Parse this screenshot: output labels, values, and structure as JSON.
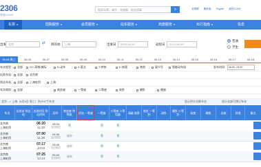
{
  "brand": {
    "logo": "2306",
    "subtitle": "铁路12306"
  },
  "search": {
    "placeholder": "搜索车票、餐饮、常旅客、相关规章"
  },
  "toplinks": [
    "无障碍",
    "敬老版",
    "English",
    "我的12306"
  ],
  "nav": [
    "车票",
    "团购服务",
    "会员服务",
    "站车服务",
    "商旅服务",
    "出行指南",
    "信息"
  ],
  "query": {
    "from_label": "出发地",
    "from_value": "北京",
    "to_label": "目的地",
    "to_value": "上海",
    "date_label": "出发日",
    "date_value": "2024-06-05",
    "return_label": "返程日",
    "return_value": "2024-06-05",
    "options": [
      "普通",
      "学生"
    ]
  },
  "dates": [
    "06-05 周三",
    "06-06",
    "06-07",
    "06-08",
    "06-09",
    "06-10",
    "06-11",
    "06-12",
    "06-13",
    "06-14",
    "06-15",
    "06-16",
    "06-17",
    "06-18"
  ],
  "filters": {
    "types_label": "车次类型：",
    "types": [
      "全部",
      "GC-高铁/城际",
      "D-动车",
      "Z-直达",
      "T-特快",
      "K-快速",
      "其他",
      "复兴号",
      "智能动车组"
    ],
    "depart_time_label": "发车时间：",
    "depart_time_value": "00:00--24:00",
    "from_label": "出发车站：",
    "from_stations": [
      "全部",
      "北京南"
    ],
    "to_label": "到达车站：",
    "to_stations": [
      "全部",
      "上海虹桥",
      "上海"
    ],
    "seat_label": "车次席别：",
    "seats": [
      "全部",
      "商务座",
      "一等座",
      "二等座",
      "软卧",
      "硬卧",
      "硬座"
    ]
  },
  "notice": "北京 --> 上海（6月5日 周三）共计47个车次",
  "notice_right": [
    "显示积分兑换车次",
    "显示全部可预订车次"
  ],
  "table": {
    "headers": [
      "车次",
      "出发站 到达站",
      "出发时间 到达时间",
      "历时",
      "商务座 特等座",
      "优选 一等座",
      "一等座",
      "二等座 二等包座",
      "高级 软卧",
      "软卧 一等卧",
      "动卧",
      "硬卧 二等卧",
      "软座",
      "硬座",
      "无座",
      "其他",
      "备注"
    ],
    "rows": [
      {
        "from": "北京南",
        "to": "上海虹桥",
        "dep": "06:20",
        "arr": "11:29",
        "dur": "05:09",
        "dur_sub": "当日到达",
        "sw": "有",
        "yd": "有",
        "ed": "有"
      },
      {
        "from": "北京南",
        "to": "上海虹桥",
        "dep": "07:00",
        "arr": "11:36",
        "dur": "04:36",
        "dur_sub": "当日到达",
        "sw": "候补",
        "yd": "有",
        "ed": "有"
      },
      {
        "from": "北京南",
        "to": "上海虹桥",
        "dep": "07:17",
        "arr": "13:03",
        "dur": "05:46",
        "dur_sub": "当日到达",
        "sw": "候补",
        "yd": "有",
        "ed": "有"
      },
      {
        "from": "北京南",
        "to": "上海虹桥",
        "dep": "07:25",
        "arr": "13:14",
        "dur": "05:49",
        "dur_sub": "当日到达",
        "sw": "候补",
        "yd": "有",
        "ed": "有"
      }
    ]
  },
  "colors": {
    "primary": "#3b82e0",
    "highlight": "#e23a3a",
    "available": "#26a269"
  }
}
